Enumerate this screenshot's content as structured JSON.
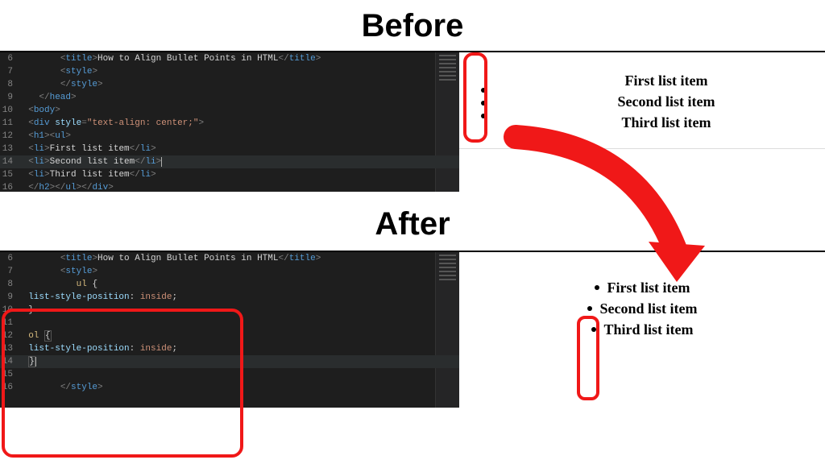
{
  "headings": {
    "before": "Before",
    "after": "After"
  },
  "before": {
    "code": {
      "title_text": "How to Align Bullet Points in HTML",
      "div_style": "text-align: center;",
      "items": [
        "First list item",
        "Second list item",
        "Third list item"
      ],
      "line_numbers": [
        "6",
        "7",
        "8",
        "9",
        "10",
        "11",
        "12",
        "13",
        "14",
        "15",
        "16"
      ]
    },
    "render": {
      "items": [
        "First list item",
        "Second list item",
        "Third list item"
      ]
    }
  },
  "after": {
    "code": {
      "title_text": "How to Align Bullet Points in HTML",
      "css_rules": [
        {
          "selector": "ul",
          "prop": "list-style-position",
          "value": "inside"
        },
        {
          "selector": "ol",
          "prop": "list-style-position",
          "value": "inside"
        }
      ],
      "line_numbers": [
        "6",
        "7",
        "8",
        "9",
        "10",
        "11",
        "12",
        "13",
        "14",
        "15",
        "16"
      ]
    },
    "render": {
      "items": [
        "First list item",
        "Second list item",
        "Third list item"
      ]
    }
  }
}
